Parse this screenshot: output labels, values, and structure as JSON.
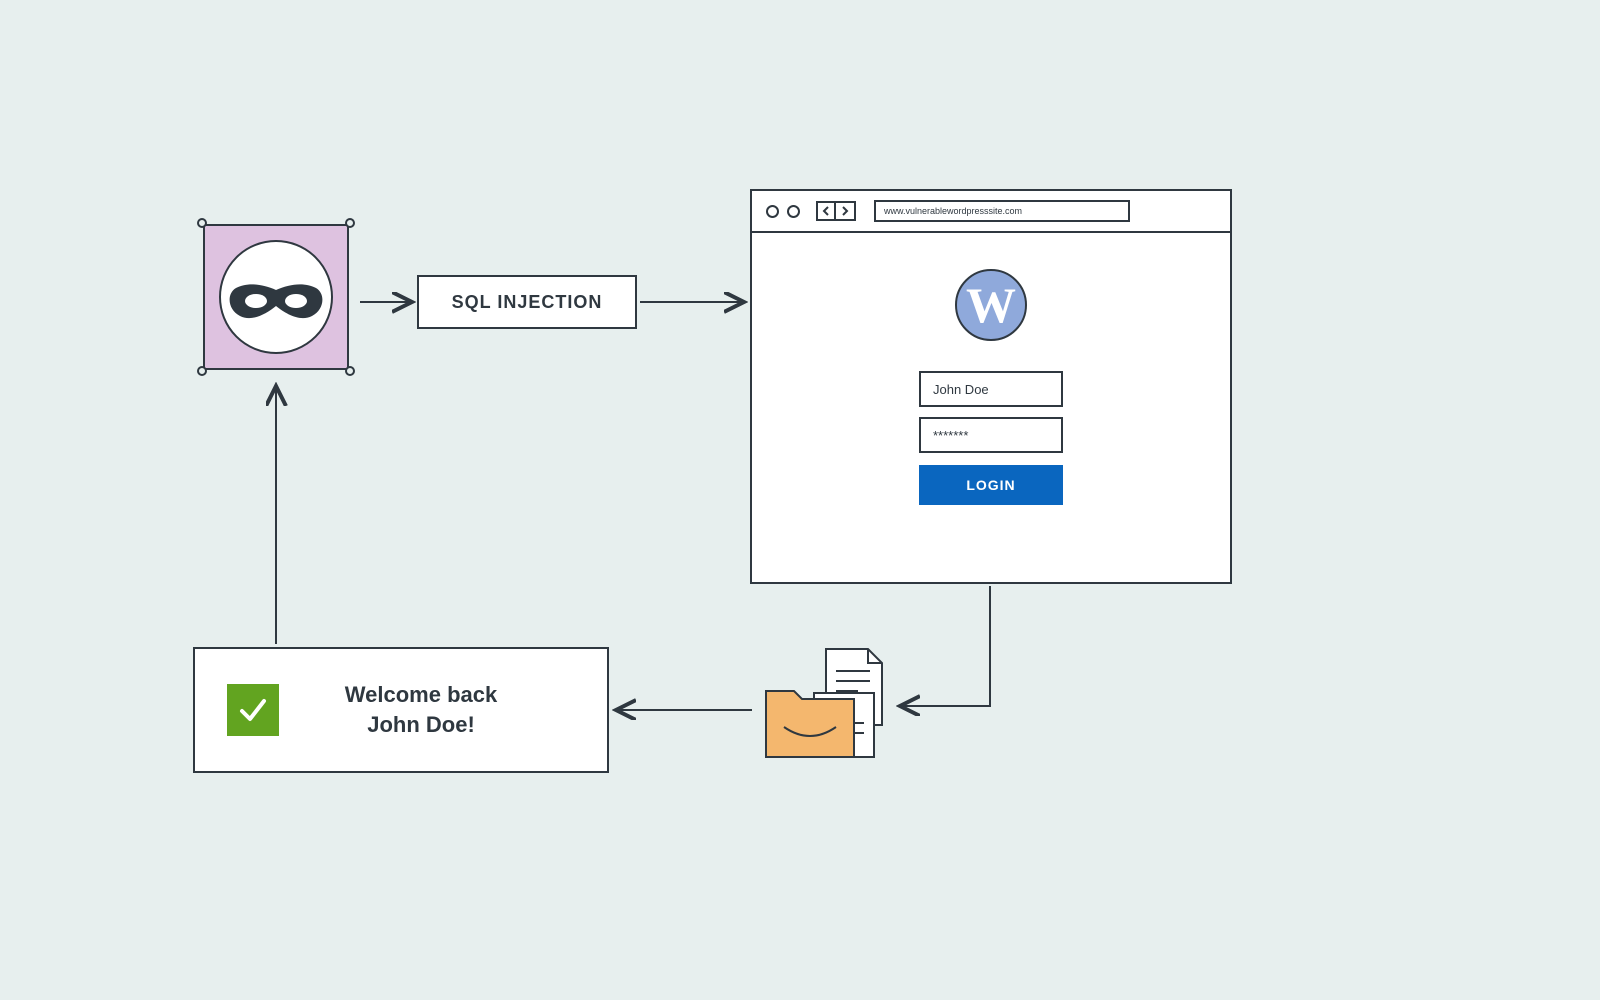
{
  "labels": {
    "sql": "SQL INJECTION"
  },
  "browser": {
    "url": "www.vulnerablewordpresssite.com",
    "logo_letter": "W",
    "username": "John Doe",
    "password": "*******",
    "login_label": "LOGIN"
  },
  "welcome": {
    "line1": "Welcome back",
    "line2": "John Doe!"
  },
  "icons": {
    "hacker": "hacker-mask-icon",
    "check": "checkmark-icon",
    "folder": "folder-documents-icon",
    "wp": "wordpress-logo-icon"
  },
  "colors": {
    "stroke": "#2f3840",
    "bg": "#e7efee",
    "hacker_bg": "#dec2e0",
    "wp_blue": "#8fa9db",
    "login_blue": "#0a66bf",
    "check_green": "#62a420",
    "folder": "#f4b76e"
  }
}
